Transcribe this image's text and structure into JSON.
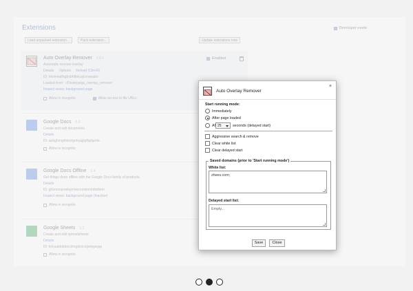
{
  "background_page": {
    "title": "Extensions",
    "developer_mode_label": "Developer mode",
    "toolbar": {
      "load_unpacked": "Load unpacked extension...",
      "pack": "Pack extension...",
      "update": "Update extensions now"
    },
    "extensions": [
      {
        "name": "Auto Overlay Remover",
        "version": "1.0.7",
        "description": "Automatic remove overlay",
        "details": "Details",
        "options": "Options",
        "reload": "Reload (Ctrl+R)",
        "id": "ID: hkeinnalfhgbobfdbocajconeeabo",
        "loaded_from": "Loaded from: ~/Desktop/gs_overlay_remover",
        "inspect": "Inspect views: background page",
        "allow_incognito": "Allow in incognito",
        "allow_file_urls": "Allow access to file URLs",
        "enabled_label": "Enabled"
      },
      {
        "name": "Google Docs",
        "version": "0.9",
        "description": "Create and edit documents",
        "details": "Details",
        "id": "ID: aohghmighlieiclgnhoajjlgfbpfgmfa",
        "allow_incognito": "Allow in incognito"
      },
      {
        "name": "Google Docs Offline",
        "version": "1.4",
        "description": "Get things done offline with the Google Docs family of products.",
        "details": "Details",
        "id": "ID: ghbmnnjooekpmoecnnnilnnbdlolhkhi",
        "inspect": "Inspect views: background page (Inactive)",
        "allow_incognito": "Allow in incognito"
      },
      {
        "name": "Google Sheets",
        "version": "1.1",
        "description": "Create and edit spreadsheets",
        "details": "Details",
        "id": "ID: felcaaldnbdncclmgdcncolpebgiejap",
        "allow_incognito": "Allow in incognito"
      }
    ]
  },
  "dialog": {
    "title": "Auto Overlay Remover",
    "close_glyph": "×",
    "start_mode_heading": "Start running mode:",
    "options": {
      "immediately": "Immediately",
      "after_page_loaded": "After page loaded",
      "after": "After",
      "seconds_suffix": "seconds (delayed start)"
    },
    "delay_value": "25",
    "checkboxes": {
      "aggressive": "Aggressive search & remove",
      "clear_white": "Clear white list",
      "clear_delayed": "Clear delayed start"
    },
    "saved_domains_legend": "Saved domains (prior to 'Start running mode')",
    "white_list_label": "White list:",
    "white_list_value": "zhees.com;",
    "delayed_list_label": "Delayed start list:",
    "delayed_list_value": "Empty...",
    "save_label": "Save",
    "close_label": "Close"
  },
  "pagination": {
    "count": 3,
    "active_index": 1
  },
  "colors": {
    "link": "#2c4f9e",
    "checkbox_checked": "#6b8fd6",
    "page_bg": "#f2f2f2"
  }
}
